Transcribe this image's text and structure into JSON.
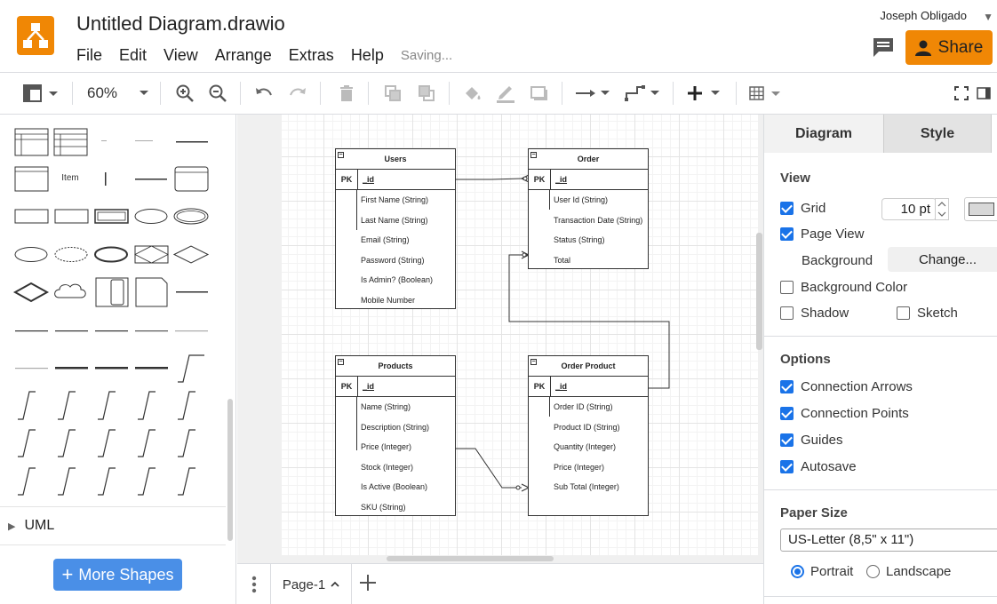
{
  "app": {
    "doc_title": "Untitled Diagram.drawio",
    "status": "Saving...",
    "user": "Joseph Obligado",
    "share_label": "Share"
  },
  "menu": [
    "File",
    "Edit",
    "View",
    "Arrange",
    "Extras",
    "Help"
  ],
  "toolbar": {
    "zoom": "60%"
  },
  "sidebar": {
    "section": "UML",
    "more_shapes_label": "More Shapes",
    "shape_labels": {
      "item": "Item"
    }
  },
  "pages": {
    "current": "Page-1"
  },
  "diagram": {
    "tables": [
      {
        "title": "Users",
        "pk": "PK",
        "pk_field": "_id",
        "fields": [
          "First Name (String)",
          "Last Name (String)",
          "Email (String)",
          "Password (String)",
          "Is Admin? (Boolean)",
          "Mobile Number"
        ]
      },
      {
        "title": "Order",
        "pk": "PK",
        "pk_field": "_id",
        "fields": [
          "User Id (String)",
          "Transaction Date (String)",
          "Status (String)",
          "Total"
        ]
      },
      {
        "title": "Products",
        "pk": "PK",
        "pk_field": "_id",
        "fields": [
          "Name (String)",
          "Description (String)",
          "Price (Integer)",
          "Stock (Integer)",
          "Is Active (Boolean)",
          "SKU (String)"
        ]
      },
      {
        "title": "Order Product",
        "pk": "PK",
        "pk_field": "_id",
        "fields": [
          "Order ID (String)",
          "Product ID (String)",
          "Quantity (Integer)",
          "Price (Integer)",
          "Sub Total (Integer)"
        ]
      }
    ]
  },
  "format_panel": {
    "tabs": [
      "Diagram",
      "Style"
    ],
    "view": {
      "title": "View",
      "grid": {
        "label": "Grid",
        "checked": true,
        "size": "10 pt"
      },
      "page_view": {
        "label": "Page View",
        "checked": true
      },
      "background_label": "Background",
      "change_label": "Change...",
      "background_color": {
        "label": "Background Color",
        "checked": false
      },
      "shadow": {
        "label": "Shadow",
        "checked": false
      },
      "sketch": {
        "label": "Sketch",
        "checked": false
      },
      "grid_color": "#d8d8d8"
    },
    "options": {
      "title": "Options",
      "items": [
        {
          "label": "Connection Arrows",
          "checked": true
        },
        {
          "label": "Connection Points",
          "checked": true
        },
        {
          "label": "Guides",
          "checked": true
        },
        {
          "label": "Autosave",
          "checked": true
        }
      ]
    },
    "paper": {
      "title": "Paper Size",
      "size": "US-Letter (8,5\" x 11\")",
      "portrait_label": "Portrait",
      "landscape_label": "Landscape",
      "orientation": "portrait"
    }
  },
  "colors": {
    "accent": "#f08705",
    "primary": "#1a73e8",
    "more_shapes": "#4a8fe7"
  }
}
